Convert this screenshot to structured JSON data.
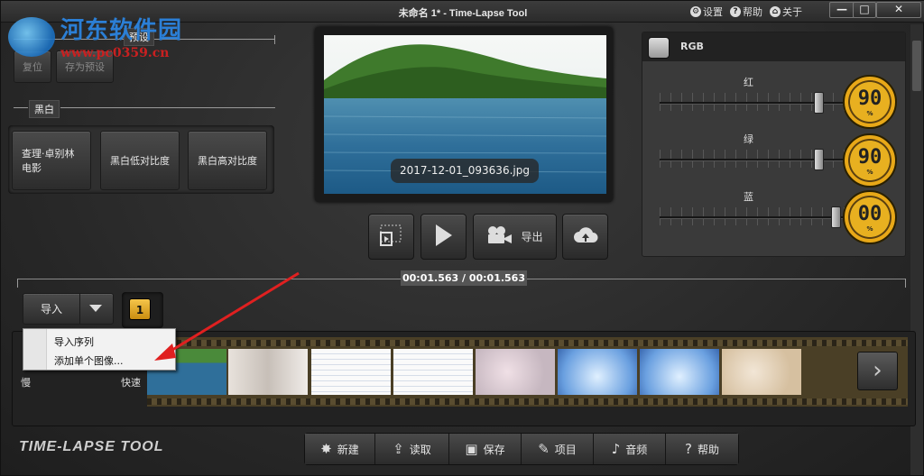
{
  "window": {
    "title": "未命名 1* - Time-Lapse Tool",
    "settings_label": "设置",
    "help_label": "帮助",
    "about_label": "关于",
    "minimize": "—",
    "maximize": "□",
    "close": "✕"
  },
  "watermark": {
    "name": "河东软件园",
    "url": "www.pc0359.cn"
  },
  "presets": {
    "section_label": "预设",
    "reset_label": "复位",
    "save_preset_label": "存为预设"
  },
  "bw": {
    "section_label": "黑白",
    "buttons": [
      "查理·卓别林电影",
      "黑白低对比度",
      "黑白高对比度"
    ]
  },
  "preview": {
    "filename": "2017-12-01_093636.jpg"
  },
  "transport": {
    "export_label": "导出"
  },
  "rgb": {
    "title": "RGB",
    "channels": [
      {
        "label": "红",
        "value": "90",
        "unit": "%",
        "level": 0.9
      },
      {
        "label": "绿",
        "value": "90",
        "unit": "%",
        "level": 0.9
      },
      {
        "label": "蓝",
        "value": "00",
        "unit": "%",
        "level": 1.0
      }
    ],
    "accent": "#e8b020"
  },
  "timeline": {
    "time": "00:01.563 / 00:01.563",
    "import_label": "导入",
    "badge": "1",
    "slow_label": "慢",
    "fast_label": "快速"
  },
  "import_menu": {
    "items": [
      "导入序列",
      "添加单个图像..."
    ]
  },
  "brand": "TIME-LAPSE TOOL",
  "bottom_bar": {
    "items": [
      {
        "label": "新建",
        "icon": "✸"
      },
      {
        "label": "读取",
        "icon": "⇪"
      },
      {
        "label": "保存",
        "icon": "▣"
      },
      {
        "label": "项目",
        "icon": "✎"
      },
      {
        "label": "音频",
        "icon": "♪"
      },
      {
        "label": "帮助",
        "icon": "?"
      }
    ]
  }
}
